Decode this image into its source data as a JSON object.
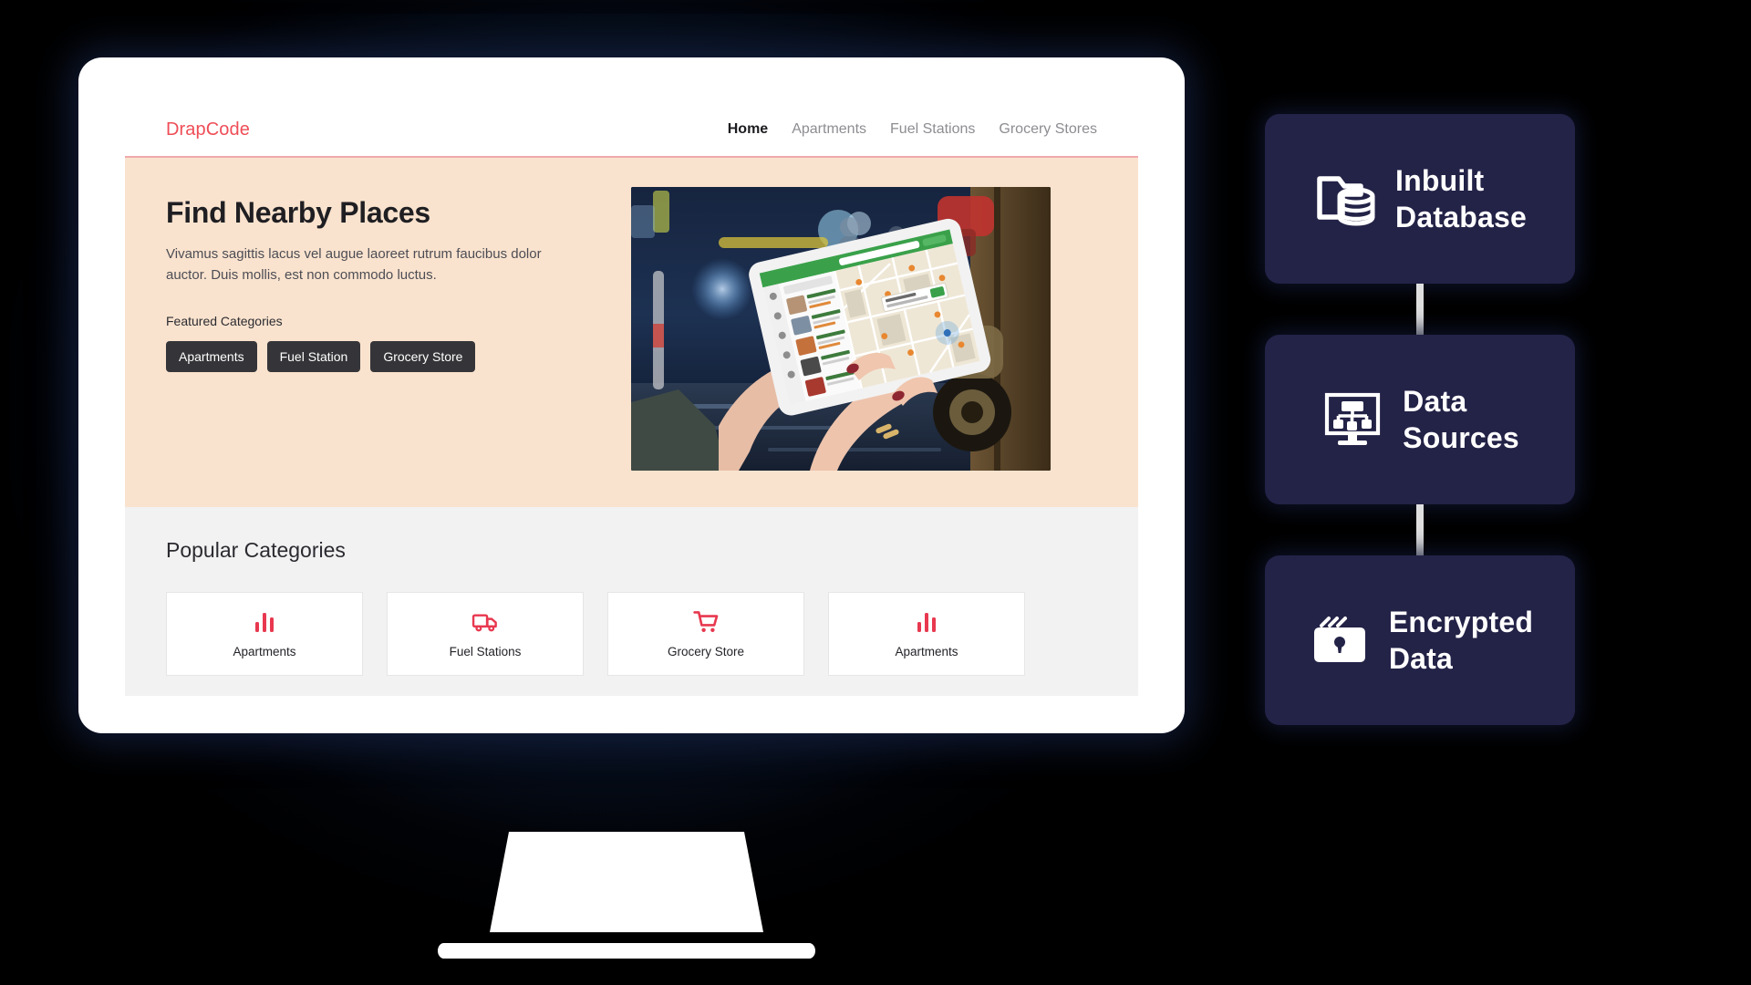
{
  "theme": {
    "brand_red": "#ef4d57",
    "hero_bg": "#FAE3CE",
    "section_bg": "#F2F2F2",
    "chip_bg": "#353539",
    "badge_bg": "#232247",
    "page_bg": "#000000"
  },
  "site": {
    "brand": "DrapCode",
    "nav": [
      {
        "label": "Home",
        "active": true
      },
      {
        "label": "Apartments",
        "active": false
      },
      {
        "label": "Fuel Stations",
        "active": false
      },
      {
        "label": "Grocery Stores",
        "active": false
      }
    ]
  },
  "hero": {
    "title": "Find Nearby Places",
    "subtitle": "Vivamus sagittis lacus vel augue laoreet rutrum faucibus dolor auctor. Duis mollis, est non commodo luctus.",
    "featured_label": "Featured Categories",
    "chips": [
      {
        "label": "Apartments"
      },
      {
        "label": "Fuel Station"
      },
      {
        "label": "Grocery Store"
      }
    ],
    "image_alt": "Hands holding a tablet showing a map app with nearby restaurant listings on a wet night street"
  },
  "popular": {
    "title": "Popular Categories",
    "cards": [
      {
        "label": "Apartments",
        "icon": "bar-chart-icon"
      },
      {
        "label": "Fuel Stations",
        "icon": "truck-icon"
      },
      {
        "label": "Grocery Store",
        "icon": "shopping-cart-icon"
      },
      {
        "label": "Apartments",
        "icon": "bar-chart-icon"
      }
    ]
  },
  "badges": [
    {
      "line1": "Inbuilt",
      "line2": "Database",
      "icon": "folder-database-icon"
    },
    {
      "line1": "Data",
      "line2": "Sources",
      "icon": "monitor-sitemap-icon"
    },
    {
      "line1": "Encrypted",
      "line2": "Data",
      "icon": "folder-lock-icon"
    }
  ]
}
